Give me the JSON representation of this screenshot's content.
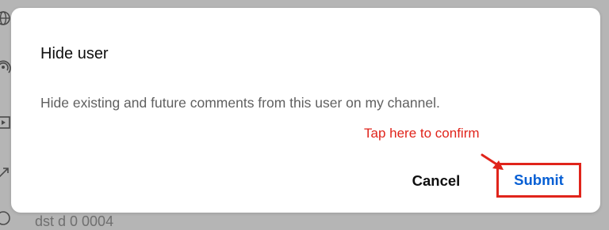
{
  "background": {
    "bottom_text": "dst    d    0 0004"
  },
  "dialog": {
    "title": "Hide user",
    "body": "Hide existing and future comments from this user on my channel.",
    "cancel_label": "Cancel",
    "submit_label": "Submit"
  },
  "annotation": {
    "text": "Tap here to confirm",
    "color": "#e0241b"
  },
  "colors": {
    "accent": "#065fd4",
    "overlay": "#b5b5b5"
  },
  "icons": [
    "globe-icon",
    "podcast-icon",
    "video-icon",
    "trending-icon",
    "clock-icon",
    "pointer-arrow-icon"
  ]
}
